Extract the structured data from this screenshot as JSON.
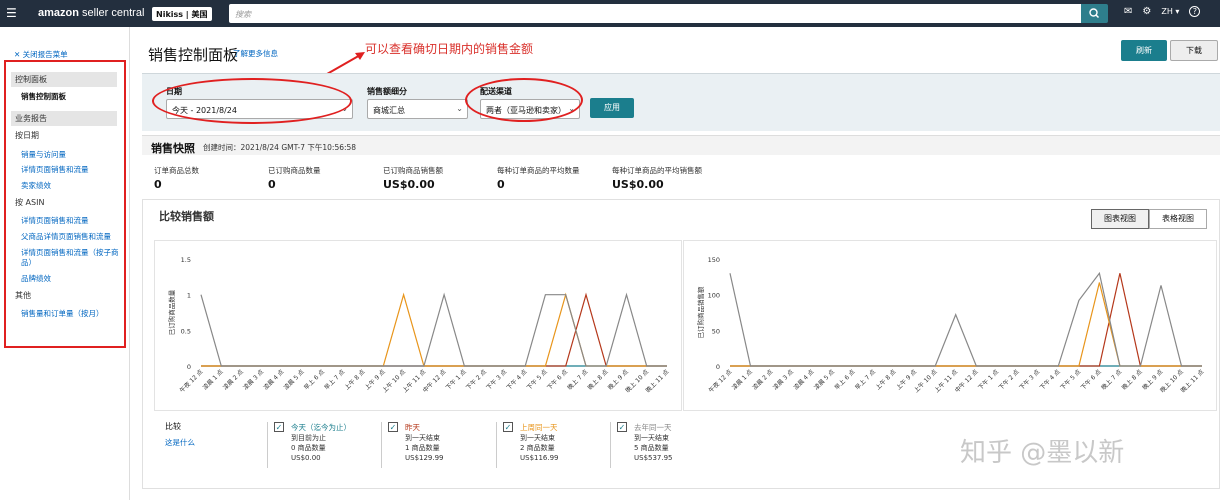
{
  "topbar": {
    "menu_icon": "☰",
    "logo_bold": "amazon",
    "logo_light": " seller central",
    "store": "Nikiss | 美国",
    "search_placeholder": "搜索",
    "search_icon": "search-icon",
    "mail_icon": "✉",
    "gear_icon": "⚙",
    "lang": "ZH ▾",
    "help_icon": "?"
  },
  "sidebar": {
    "close_label": "✕ 关闭报告菜单",
    "sections": [
      {
        "label": "控制面板"
      },
      {
        "label": "业务报告"
      }
    ],
    "active_item": "销售控制面板",
    "groups": [
      "按日期",
      "按 ASIN",
      "其他"
    ],
    "date_items": [
      "销量与访问量",
      "详情页面销售和流量",
      "卖家绩效"
    ],
    "asin_items": [
      "详情页面销售和流量",
      "父商品详情页面销售和流量",
      "详情页面销售和流量（按子商品）",
      "品牌绩效"
    ],
    "other_items": [
      "销售量和订单量（按月）"
    ]
  },
  "header": {
    "title": "销售控制面板",
    "learn_more": "了解更多信息",
    "annotation": "可以查看确切日期内的销售金额",
    "refresh_label": "刷新",
    "download_label": "下载"
  },
  "filters": {
    "date_label": "日期",
    "date_value": "今天 - 2021/8/24",
    "breakdown_label": "销售额细分",
    "breakdown_value": "商城汇总",
    "channel_label": "配送渠道",
    "channel_value": "两者（亚马逊和卖家）",
    "apply_label": "应用"
  },
  "snapshot": {
    "title": "销售快照",
    "time": "创建时间：2021/8/24 GMT-7 下午10:56:58",
    "metrics": [
      {
        "label": "订单商品总数",
        "value": "0"
      },
      {
        "label": "已订购商品数量",
        "value": "0"
      },
      {
        "label": "已订购商品销售额",
        "value": "US$0.00"
      },
      {
        "label": "每种订单商品的平均数量",
        "value": "0"
      },
      {
        "label": "每种订单商品的平均销售额",
        "value": "US$0.00"
      }
    ]
  },
  "compare": {
    "title": "比较销售额",
    "chart_view": "图表视图",
    "table_view": "表格视图",
    "compare_label": "比较",
    "what_is_this": "这是什么",
    "legend": [
      {
        "title": "今天（迄今为止）",
        "line1": "到目前为止",
        "line2": "0 商品数量",
        "line3": "US$0.00",
        "color": "#1b7e8d",
        "check": "✓"
      },
      {
        "title": "昨天",
        "line1": "到一天结束",
        "line2": "1 商品数量",
        "line3": "US$129.99",
        "color": "#b5381b",
        "check": "✓"
      },
      {
        "title": "上周同一天",
        "line1": "到一天结束",
        "line2": "2 商品数量",
        "line3": "US$116.99",
        "color": "#e8951b",
        "check": "✓"
      },
      {
        "title": "去年同一天",
        "line1": "到一天结束",
        "line2": "5 商品数量",
        "line3": "US$537.95",
        "color": "#888888",
        "check": "✓"
      }
    ]
  },
  "watermark": "知乎 @墨以新",
  "chart_data": [
    {
      "type": "line",
      "ylabel": "已订购商品数量",
      "ylim": [
        0,
        1.5
      ],
      "yticks": [
        "0",
        "0.5",
        "1",
        "1.5"
      ],
      "categories": [
        "午夜 12 点",
        "凌晨 1 点",
        "凌晨 2 点",
        "凌晨 3 点",
        "凌晨 4 点",
        "凌晨 5 点",
        "早上 6 点",
        "早上 7 点",
        "上午 8 点",
        "上午 9 点",
        "上午 10 点",
        "上午 11 点",
        "中午 12 点",
        "下午 1 点",
        "下午 2 点",
        "下午 3 点",
        "下午 4 点",
        "下午 5 点",
        "下午 6 点",
        "晚上 7 点",
        "晚上 8 点",
        "晚上 9 点",
        "晚上 10 点",
        "晚上 11 点"
      ],
      "series": [
        {
          "color": "#1b7e8d",
          "values": [
            0,
            0,
            0,
            0,
            0,
            0,
            0,
            0,
            0,
            0,
            0,
            0,
            0,
            0,
            0,
            0,
            0,
            0,
            0,
            0,
            0,
            0,
            0,
            0
          ]
        },
        {
          "color": "#b5381b",
          "values": [
            0,
            0,
            0,
            0,
            0,
            0,
            0,
            0,
            0,
            0,
            0,
            0,
            0,
            0,
            0,
            0,
            0,
            0,
            0,
            1,
            0,
            0,
            0,
            0
          ]
        },
        {
          "color": "#e8951b",
          "values": [
            0,
            0,
            0,
            0,
            0,
            0,
            0,
            0,
            0,
            0,
            1,
            0,
            0,
            0,
            0,
            0,
            0,
            0,
            1,
            0,
            0,
            0,
            0,
            0
          ]
        },
        {
          "color": "#888888",
          "values": [
            1,
            0,
            0,
            0,
            0,
            0,
            0,
            0,
            0,
            0,
            0,
            0,
            1,
            0,
            0,
            0,
            0,
            1,
            1,
            0,
            0,
            1,
            0,
            0
          ]
        }
      ]
    },
    {
      "type": "line",
      "ylabel": "已订购商品销售额",
      "ylim": [
        0,
        150
      ],
      "yticks": [
        "0",
        "50",
        "100",
        "150"
      ],
      "categories": [
        "午夜 12 点",
        "凌晨 1 点",
        "凌晨 2 点",
        "凌晨 3 点",
        "凌晨 4 点",
        "凌晨 5 点",
        "早上 6 点",
        "早上 7 点",
        "上午 8 点",
        "上午 9 点",
        "上午 10 点",
        "上午 11 点",
        "中午 12 点",
        "下午 1 点",
        "下午 2 点",
        "下午 3 点",
        "下午 4 点",
        "下午 5 点",
        "下午 6 点",
        "晚上 7 点",
        "晚上 8 点",
        "晚上 9 点",
        "晚上 10 点",
        "晚上 11 点"
      ],
      "series": [
        {
          "color": "#1b7e8d",
          "values": [
            0,
            0,
            0,
            0,
            0,
            0,
            0,
            0,
            0,
            0,
            0,
            0,
            0,
            0,
            0,
            0,
            0,
            0,
            0,
            0,
            0,
            0,
            0,
            0
          ]
        },
        {
          "color": "#b5381b",
          "values": [
            0,
            0,
            0,
            0,
            0,
            0,
            0,
            0,
            0,
            0,
            0,
            0,
            0,
            0,
            0,
            0,
            0,
            0,
            0,
            130,
            0,
            0,
            0,
            0
          ]
        },
        {
          "color": "#e8951b",
          "values": [
            0,
            0,
            0,
            0,
            0,
            0,
            0,
            0,
            0,
            0,
            0,
            0,
            0,
            0,
            0,
            0,
            0,
            0,
            117,
            0,
            0,
            0,
            0,
            0
          ]
        },
        {
          "color": "#888888",
          "values": [
            130,
            0,
            0,
            0,
            0,
            0,
            0,
            0,
            0,
            0,
            0,
            72,
            0,
            0,
            0,
            0,
            0,
            92,
            130,
            0,
            0,
            113,
            0,
            0
          ]
        }
      ]
    }
  ]
}
